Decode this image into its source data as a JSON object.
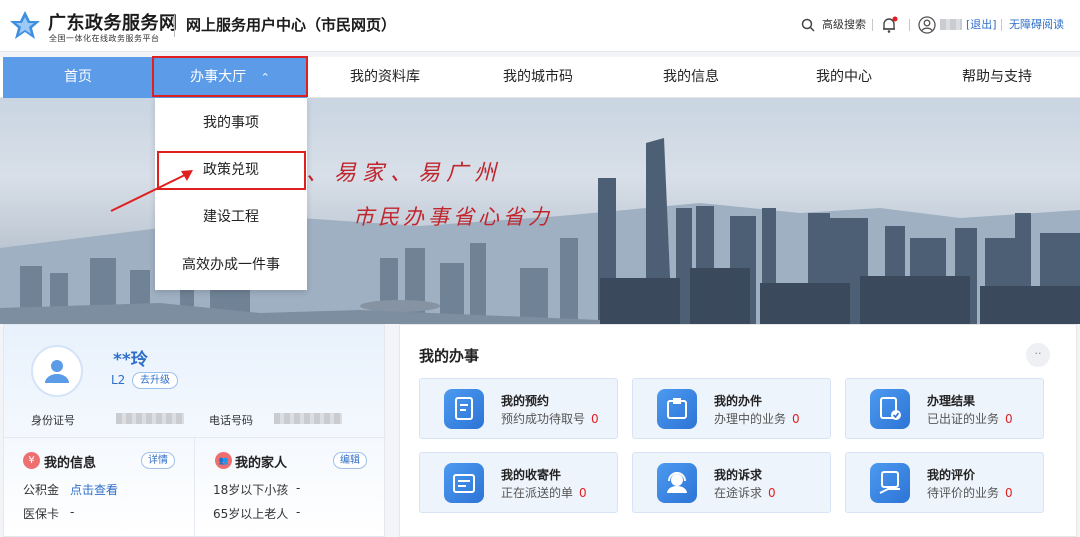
{
  "header": {
    "logo_title": "广东政务服务网",
    "logo_subtitle": "全国一体化在线政务服务平台",
    "center_title": "网上服务用户中心（市民网页）",
    "search_label": "高级搜索",
    "logout_label": "[退出]",
    "accessibility_label": "无障碍阅读"
  },
  "nav": {
    "items": [
      "首页",
      "办事大厅",
      "我的资料库",
      "我的城市码",
      "我的信息",
      "我的中心",
      "帮助与支持"
    ],
    "active_caret": "⌃"
  },
  "dropdown": {
    "items": [
      "我的事项",
      "政策兑现",
      "建设工程",
      "高效办成一件事"
    ]
  },
  "banner": {
    "slogan_line1": "、易家、易广州",
    "slogan_line2": "市民办事省心省力"
  },
  "profile": {
    "name": "**玲",
    "level": "L2",
    "upgrade_label": "去升级",
    "id_label": "身份证号",
    "phone_label": "电话号码",
    "my_info": {
      "title": "我的信息",
      "icon_glyph": "¥",
      "action": "详情",
      "rows": [
        {
          "label": "公积金",
          "value": "点击查看"
        },
        {
          "label": "医保卡",
          "value": "-"
        }
      ]
    },
    "my_family": {
      "title": "我的家人",
      "icon_glyph": "👥",
      "action": "编辑",
      "rows": [
        {
          "label": "18岁以下小孩",
          "value": "-"
        },
        {
          "label": "65岁以上老人",
          "value": "-"
        }
      ]
    }
  },
  "affairs": {
    "title": "我的办事",
    "more_glyph": "··",
    "cards": [
      {
        "title": "我的预约",
        "sub": "预约成功待取号",
        "count": "0",
        "icon": "appointment-icon"
      },
      {
        "title": "我的办件",
        "sub": "办理中的业务",
        "count": "0",
        "icon": "case-icon"
      },
      {
        "title": "办理结果",
        "sub": "已出证的业务",
        "count": "0",
        "icon": "certificate-icon"
      },
      {
        "title": "我的收寄件",
        "sub": "正在派送的单",
        "count": "0",
        "icon": "mail-icon"
      },
      {
        "title": "我的诉求",
        "sub": "在途诉求",
        "count": "0",
        "icon": "service-agent-icon"
      },
      {
        "title": "我的评价",
        "sub": "待评价的业务",
        "count": "0",
        "icon": "rating-icon"
      }
    ]
  },
  "colors": {
    "accent": "#5b9be8",
    "highlight_red": "#e02020",
    "link_blue": "#2f6fc9"
  }
}
